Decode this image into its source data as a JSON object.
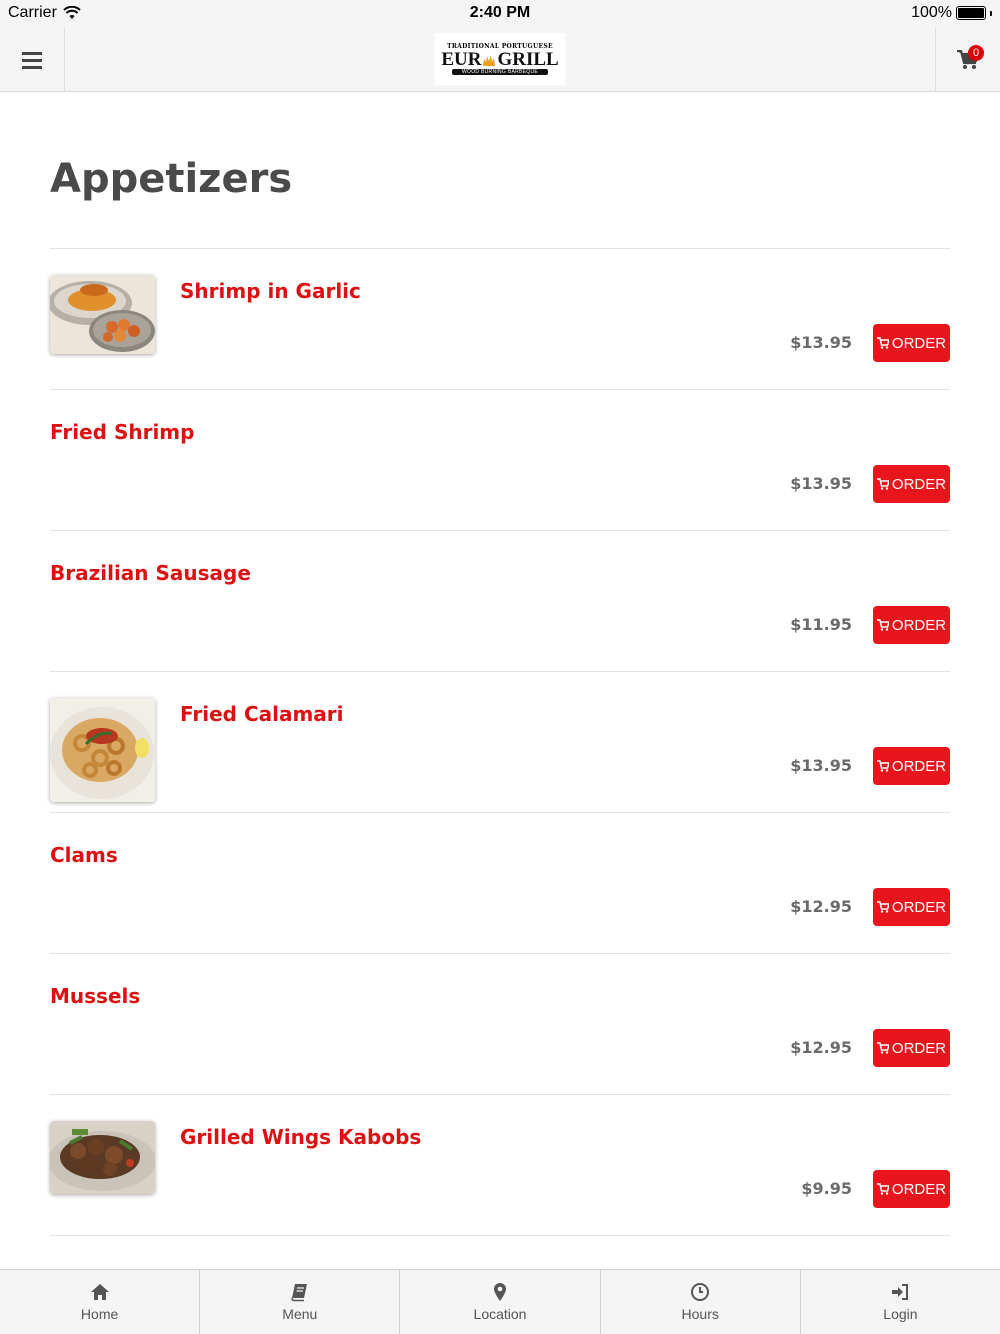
{
  "status_bar": {
    "carrier": "Carrier",
    "time": "2:40 PM",
    "battery": "100%"
  },
  "header": {
    "logo_top": "TRADITIONAL PORTUGUESE",
    "logo_left": "EUR",
    "logo_right": "GRILL",
    "logo_bottom": "WOOD BURNING BARBEQUE",
    "cart_count": "0"
  },
  "page": {
    "title": "Appetizers"
  },
  "order_label": "ORDER",
  "items": [
    {
      "name": "Shrimp in Garlic",
      "price": "$13.95",
      "image": "shrimp-garlic"
    },
    {
      "name": "Fried Shrimp",
      "price": "$13.95"
    },
    {
      "name": "Brazilian Sausage",
      "price": "$11.95"
    },
    {
      "name": "Fried Calamari",
      "price": "$13.95",
      "image": "calamari"
    },
    {
      "name": "Clams",
      "price": "$12.95"
    },
    {
      "name": "Mussels",
      "price": "$12.95"
    },
    {
      "name": "Grilled Wings Kabobs",
      "price": "$9.95",
      "image": "wings"
    }
  ],
  "tabs": [
    {
      "label": "Home",
      "icon": "home-icon"
    },
    {
      "label": "Menu",
      "icon": "book-icon"
    },
    {
      "label": "Location",
      "icon": "map-pin-icon"
    },
    {
      "label": "Hours",
      "icon": "clock-icon"
    },
    {
      "label": "Login",
      "icon": "login-icon"
    }
  ],
  "colors": {
    "accent": "#e8161c",
    "item_name": "#dd1111",
    "bar_bg": "#f5f5f5"
  }
}
